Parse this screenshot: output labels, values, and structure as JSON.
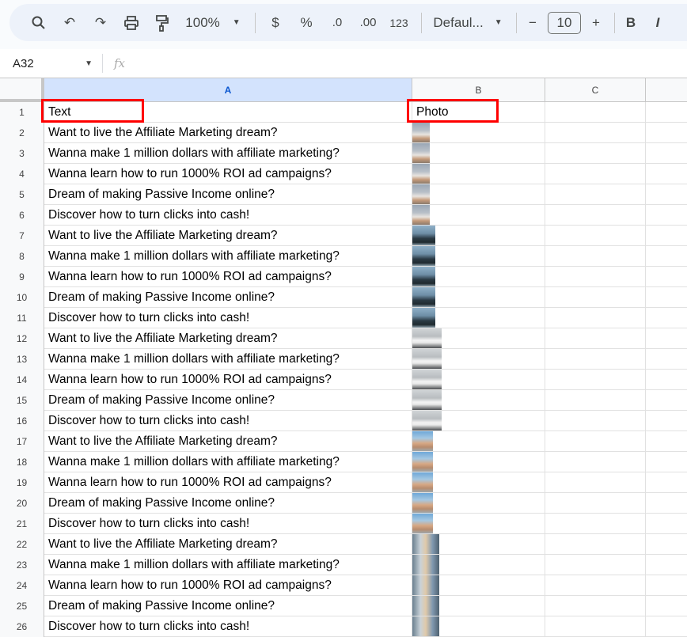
{
  "toolbar": {
    "zoom": "100%",
    "currency": "$",
    "percent": "%",
    "dec_decrease": ".0",
    "dec_increase": ".00",
    "number_format": "123",
    "font": "Defaul...",
    "font_size": "10",
    "bold": "B",
    "italic": "I",
    "minus": "−",
    "plus": "+"
  },
  "formula_bar": {
    "cell_ref": "A32",
    "fx": "fx",
    "value": ""
  },
  "columns": [
    "A",
    "B",
    "C"
  ],
  "header": {
    "row": "1",
    "a": "Text",
    "b": "Photo"
  },
  "rows": [
    {
      "n": "2",
      "text": "Want to live the Affiliate Marketing dream?",
      "photo": "p1"
    },
    {
      "n": "3",
      "text": "Wanna make 1 million dollars with affiliate marketing?",
      "photo": "p1"
    },
    {
      "n": "4",
      "text": "Wanna learn how to run 1000% ROI ad campaigns?",
      "photo": "p1"
    },
    {
      "n": "5",
      "text": "Dream of making Passive Income online?",
      "photo": "p1"
    },
    {
      "n": "6",
      "text": "Discover how to turn clicks into cash!",
      "photo": "p1"
    },
    {
      "n": "7",
      "text": "Want to live the Affiliate Marketing dream?",
      "photo": "p2"
    },
    {
      "n": "8",
      "text": "Wanna make 1 million dollars with affiliate marketing?",
      "photo": "p2"
    },
    {
      "n": "9",
      "text": "Wanna learn how to run 1000% ROI ad campaigns?",
      "photo": "p2"
    },
    {
      "n": "10",
      "text": "Dream of making Passive Income online?",
      "photo": "p2"
    },
    {
      "n": "11",
      "text": "Discover how to turn clicks into cash!",
      "photo": "p2"
    },
    {
      "n": "12",
      "text": "Want to live the Affiliate Marketing dream?",
      "photo": "p3"
    },
    {
      "n": "13",
      "text": "Wanna make 1 million dollars with affiliate marketing?",
      "photo": "p3"
    },
    {
      "n": "14",
      "text": "Wanna learn how to run 1000% ROI ad campaigns?",
      "photo": "p3"
    },
    {
      "n": "15",
      "text": "Dream of making Passive Income online?",
      "photo": "p3"
    },
    {
      "n": "16",
      "text": "Discover how to turn clicks into cash!",
      "photo": "p3"
    },
    {
      "n": "17",
      "text": "Want to live the Affiliate Marketing dream?",
      "photo": "p4"
    },
    {
      "n": "18",
      "text": "Wanna make 1 million dollars with affiliate marketing?",
      "photo": "p4"
    },
    {
      "n": "19",
      "text": "Wanna learn how to run 1000% ROI ad campaigns?",
      "photo": "p4"
    },
    {
      "n": "20",
      "text": "Dream of making Passive Income online?",
      "photo": "p4"
    },
    {
      "n": "21",
      "text": "Discover how to turn clicks into cash!",
      "photo": "p4"
    },
    {
      "n": "22",
      "text": "Want to live the Affiliate Marketing dream?",
      "photo": "p5"
    },
    {
      "n": "23",
      "text": "Wanna make 1 million dollars with affiliate marketing?",
      "photo": "p5"
    },
    {
      "n": "24",
      "text": "Wanna learn how to run 1000% ROI ad campaigns?",
      "photo": "p5"
    },
    {
      "n": "25",
      "text": "Dream of making Passive Income online?",
      "photo": "p5"
    },
    {
      "n": "26",
      "text": "Discover how to turn clicks into cash!",
      "photo": "p5"
    }
  ],
  "colors": {
    "highlight": "#ff0000",
    "selected_col": "#d3e3fd"
  }
}
